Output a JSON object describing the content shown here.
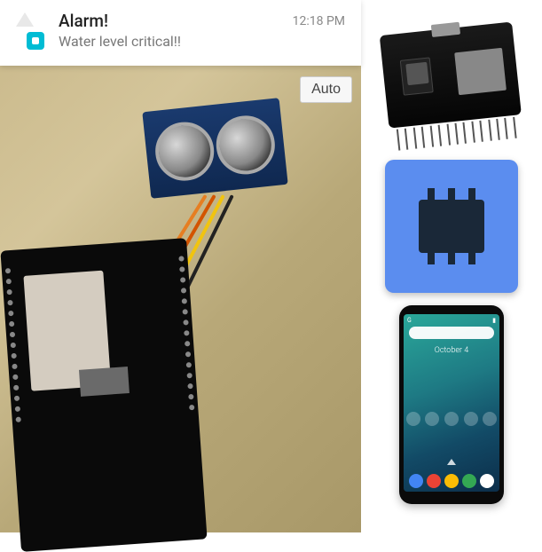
{
  "notification": {
    "title": "Alarm!",
    "body": "Water level critical!!",
    "time": "12:18 PM"
  },
  "camera": {
    "auto_label": "Auto"
  },
  "phone": {
    "date_line": "October 4"
  }
}
